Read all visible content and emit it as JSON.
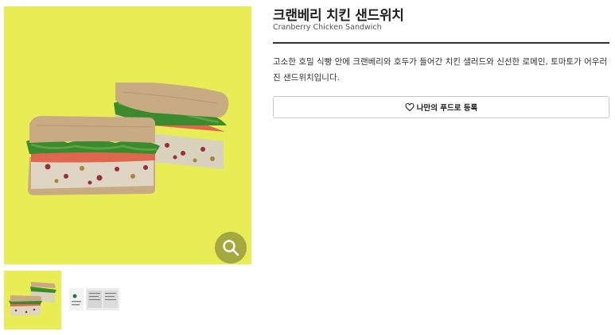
{
  "product": {
    "name_ko": "크랜베리 치킨 샌드위치",
    "name_en": "Cranberry Chicken Sandwich",
    "description": "고소한 호밀 식빵 안에 크랜베리와 호두가 들어간 치킨 샐러드와 신선한 로메인, 토마토가 어우러진 샌드위치입니다."
  },
  "actions": {
    "favorite_label": "나만의 푸드로 등록",
    "favorite_icon": "heart-outline-icon",
    "zoom_icon": "magnifier-icon"
  },
  "gallery": {
    "selected_index": 0,
    "thumbnails": [
      "sandwich-photo",
      "nutrition-label-photo"
    ]
  },
  "colors": {
    "photo_background": "#e8ec55",
    "zoom_button": "#a4a83e"
  }
}
